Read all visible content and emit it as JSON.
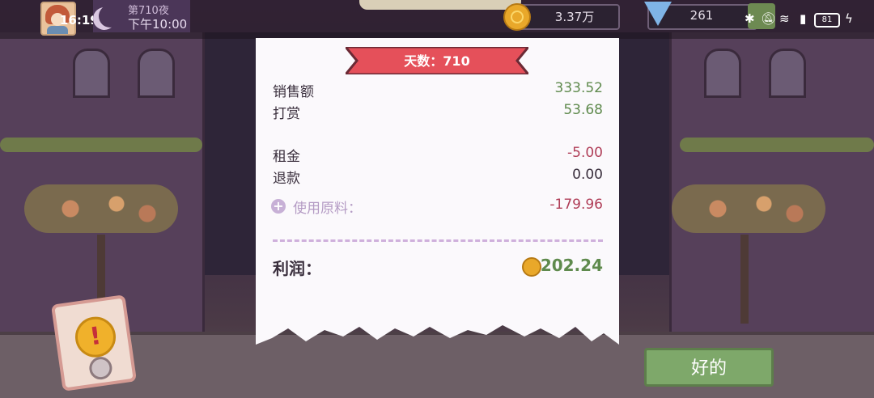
{
  "status_bar": {
    "clock": "16:19",
    "battery": "81"
  },
  "hud": {
    "night_title": "第710夜",
    "night_time": "下午10:00",
    "coins": "3.37万",
    "gems": "261"
  },
  "receipt": {
    "banner": "天数：710",
    "rows": [
      {
        "label": "销售额",
        "value": "333.52",
        "color": "#5f8a4d"
      },
      {
        "label": "打赏",
        "value": "53.68",
        "color": "#5f8a4d"
      },
      {
        "label": "租金",
        "value": "-5.00",
        "color": "#b03e58"
      },
      {
        "label": "退款",
        "value": "0.00",
        "color": "#3a2f3d"
      }
    ],
    "materials_label": "使用原料：",
    "materials_value": "-179.96",
    "profit_label": "利润：",
    "profit_value": "202.24"
  },
  "ok_button": {
    "label": "好的"
  },
  "icons": {
    "avatar": "player-avatar",
    "moon": "moon-icon",
    "coin": "coin-icon",
    "gem": "gem-icon",
    "alert": "exclamation-icon",
    "plus": "plus-icon"
  },
  "colors": {
    "positive": "#5f8a4d",
    "negative": "#b03e58",
    "banner": "#e5505a",
    "ok_button": "#7ea86a"
  }
}
